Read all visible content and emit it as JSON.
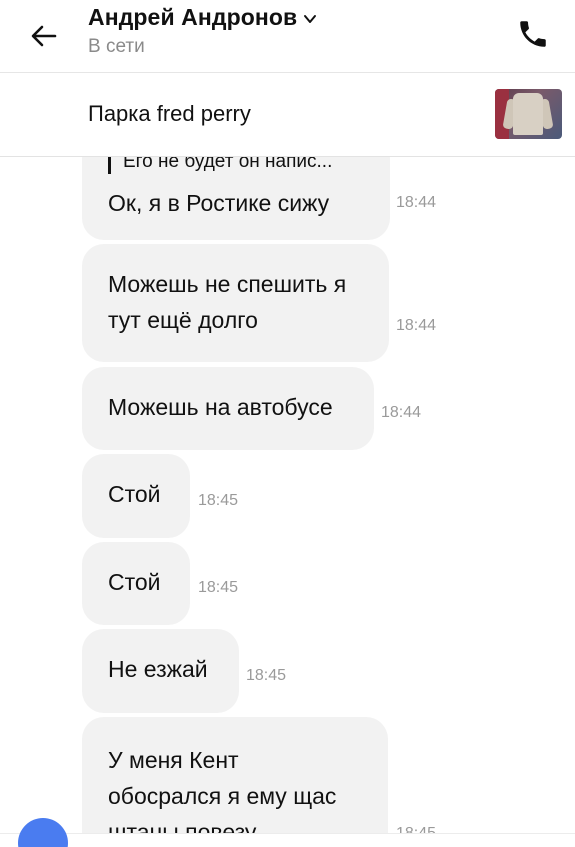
{
  "header": {
    "name": "Андрей Андронов",
    "status": "В сети"
  },
  "ad": {
    "title": "Парка fred perry"
  },
  "messages": [
    {
      "reply": "Его не будет он напис...",
      "lines": [
        "Ок, я в Ростике сижу"
      ],
      "time": "18:44"
    },
    {
      "lines": [
        "Можешь не спешить я",
        "тут ещё долго"
      ],
      "time": "18:44"
    },
    {
      "lines": [
        "Можешь на автобусе"
      ],
      "time": "18:44"
    },
    {
      "lines": [
        "Стой"
      ],
      "time": "18:45"
    },
    {
      "lines": [
        "Стой"
      ],
      "time": "18:45"
    },
    {
      "lines": [
        "Не езжай"
      ],
      "time": "18:45"
    },
    {
      "lines": [
        "У меня Кент",
        "обосрался я ему щас",
        "штаны повезу"
      ],
      "time": "18:45"
    }
  ],
  "colors": {
    "bubble": "#f2f2f2",
    "accent": "#4a7cf0",
    "muted": "#8a8a8a"
  },
  "icons": {
    "back": "arrow-left-icon",
    "chevron": "chevron-down-icon",
    "call": "phone-icon"
  }
}
